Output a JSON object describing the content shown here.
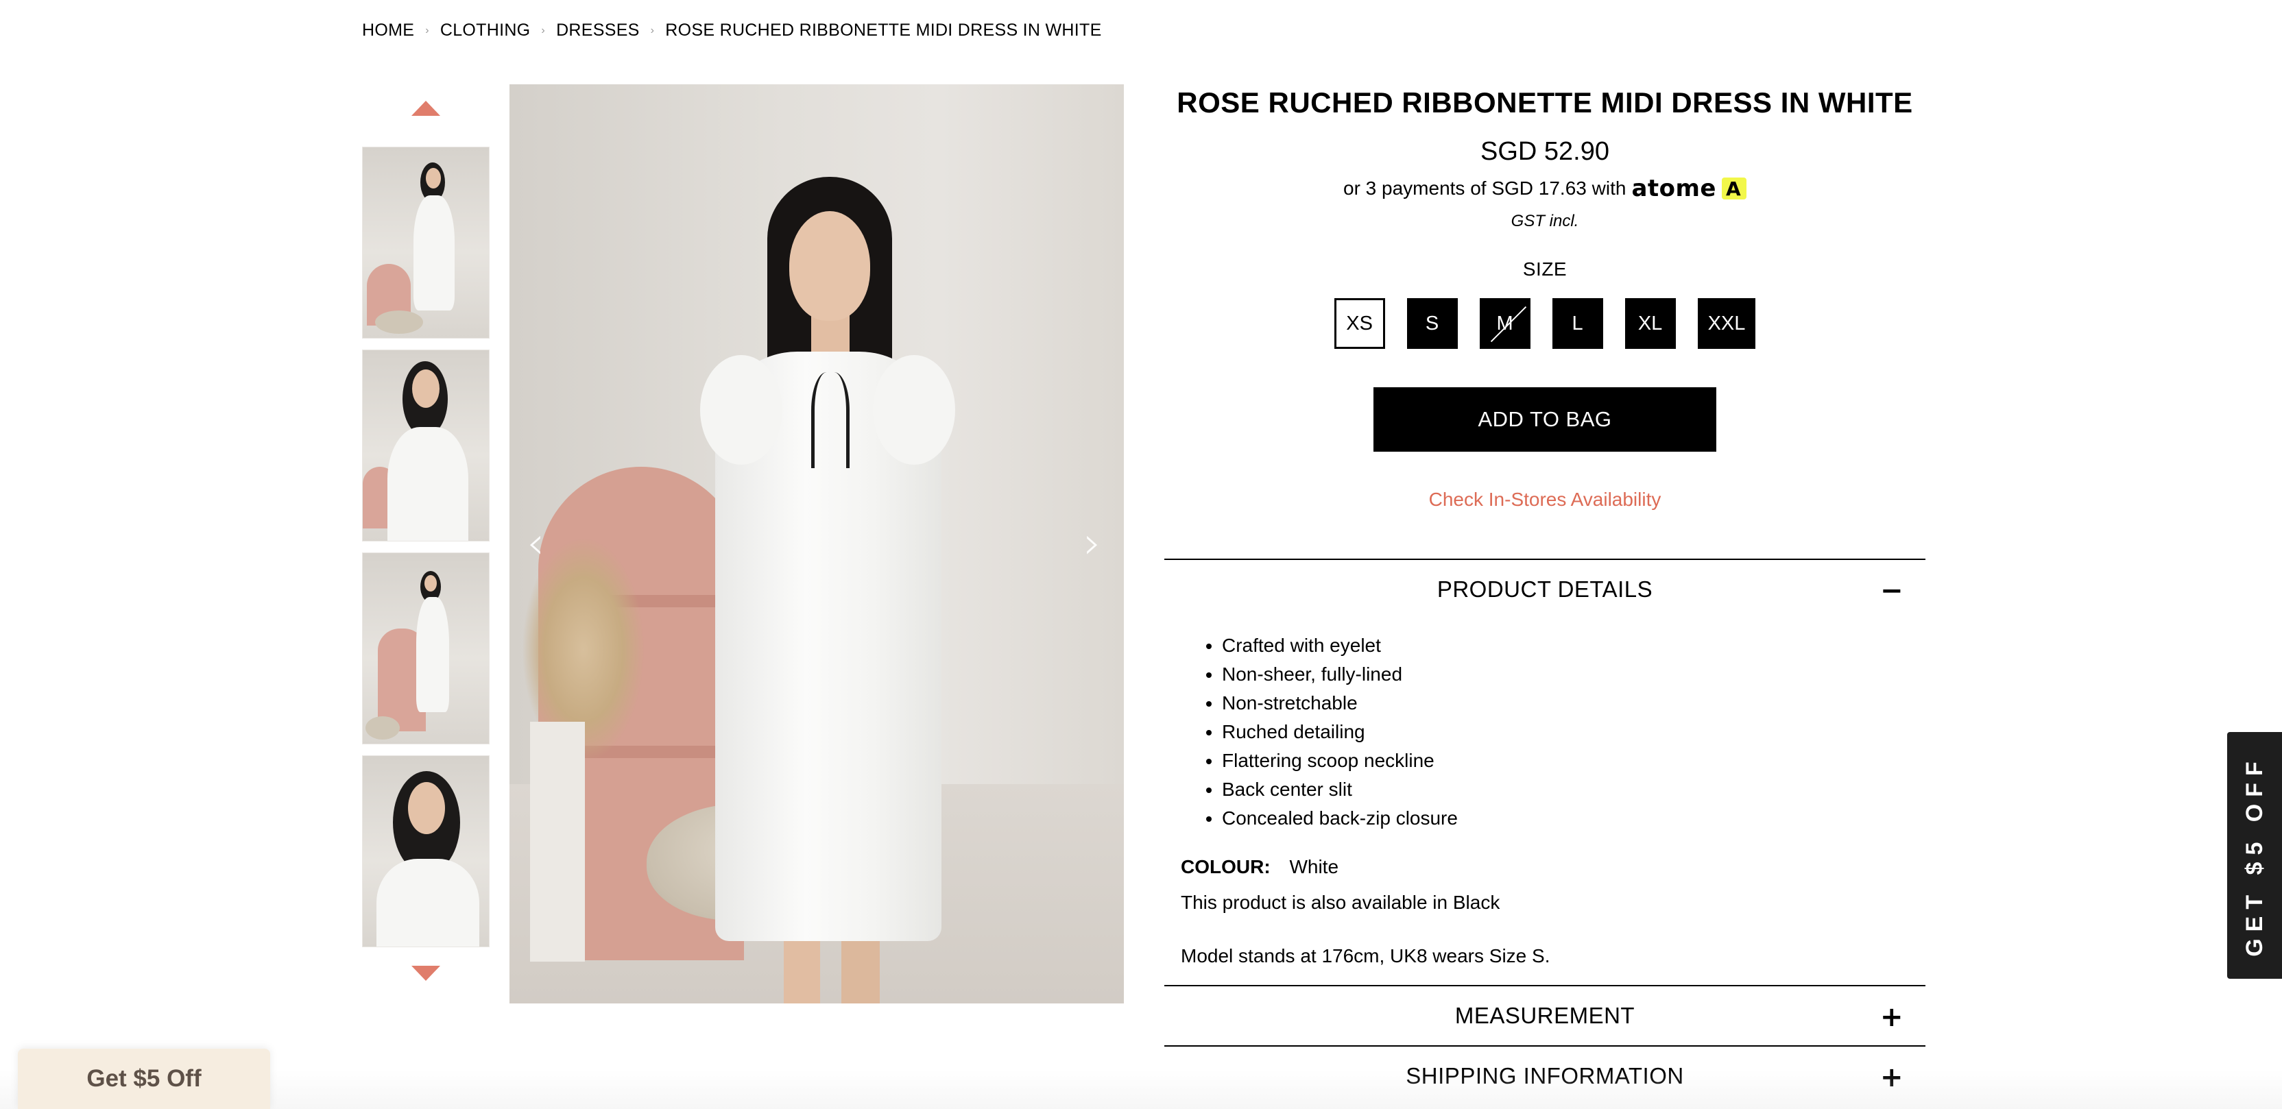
{
  "breadcrumb": {
    "items": [
      "HOME",
      "CLOTHING",
      "DRESSES",
      "ROSE RUCHED RIBBONETTE MIDI DRESS IN WHITE"
    ],
    "separator": "›"
  },
  "gallery": {
    "prev_icon": "chevron-left-icon",
    "next_icon": "chevron-right-icon",
    "thumb_up_icon": "caret-up-icon",
    "thumb_down_icon": "caret-down-icon",
    "thumbnail_count": 4,
    "arrow_color": "#e07d6b"
  },
  "product": {
    "title": "ROSE RUCHED RIBBONETTE MIDI DRESS IN WHITE",
    "price": "SGD 52.90",
    "installment_text": "or 3 payments of SGD 17.63 with",
    "installment_provider": "atome",
    "tax_note": "GST incl.",
    "size_label": "SIZE",
    "sizes": [
      {
        "label": "XS",
        "state": "selected"
      },
      {
        "label": "S",
        "state": "available"
      },
      {
        "label": "M",
        "state": "unavailable"
      },
      {
        "label": "L",
        "state": "available"
      },
      {
        "label": "XL",
        "state": "available"
      },
      {
        "label": "XXL",
        "state": "available"
      }
    ],
    "add_to_bag": "ADD TO BAG",
    "check_stores": "Check In-Stores Availability",
    "accent_color": "#dd6b55"
  },
  "accordion": {
    "details_title": "PRODUCT DETAILS",
    "details_toggle": "−",
    "details_bullets": [
      "Crafted with eyelet",
      "Non-sheer, fully-lined",
      "Non-stretchable",
      "Ruched detailing",
      "Flattering scoop neckline",
      "Back center slit",
      "Concealed back-zip closure"
    ],
    "colour_key": "COLOUR:",
    "colour_value": "White",
    "also_available": "This product is also available in Black",
    "model_note": "Model stands at 176cm, UK8 wears Size S.",
    "measurement_title": "MEASUREMENT",
    "measurement_toggle": "+",
    "shipping_title": "SHIPPING INFORMATION",
    "shipping_toggle": "+"
  },
  "promos": {
    "side_tab": "GET $5 OFF",
    "bottom_tab": "Get $5 Off"
  }
}
